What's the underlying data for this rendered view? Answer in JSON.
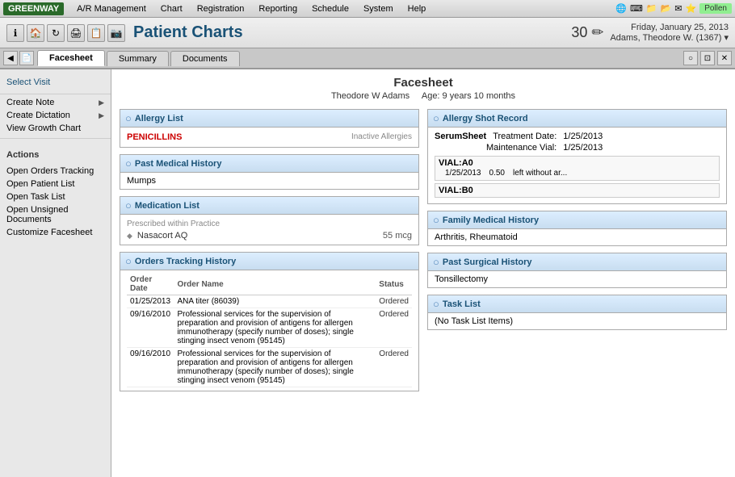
{
  "app": {
    "logo": "GREENWAY",
    "title": "Patient Charts",
    "date": "Friday, January 25, 2013",
    "patient_info": "Adams, Theodore W. (1367) ▾",
    "num_badge": "30",
    "pollen": "Pollen"
  },
  "menu": {
    "items": [
      "A/R Management",
      "Chart",
      "Registration",
      "Reporting",
      "Schedule",
      "System",
      "Help"
    ]
  },
  "tabs": {
    "active": "Facesheet",
    "items": [
      "Facesheet",
      "Summary",
      "Documents"
    ]
  },
  "sidebar": {
    "select_visit": "Select Visit",
    "links": [
      {
        "label": "Create Note",
        "arrow": true
      },
      {
        "label": "Create Dictation",
        "arrow": true
      },
      {
        "label": "View Growth Chart",
        "arrow": false
      }
    ],
    "actions_title": "Actions",
    "actions": [
      {
        "label": "Open Orders Tracking"
      },
      {
        "label": "Open Patient List"
      },
      {
        "label": "Open Task List"
      },
      {
        "label": "Open Unsigned Documents"
      },
      {
        "label": "Customize Facesheet"
      }
    ]
  },
  "facesheet": {
    "title": "Facesheet",
    "patient_name": "Theodore W Adams",
    "age": "Age: 9 years 10 months"
  },
  "allergy_list": {
    "section_title": "Allergy List",
    "inactive_label": "Inactive Allergies",
    "items": [
      "PENICILLINS"
    ]
  },
  "allergy_shot": {
    "section_title": "Allergy Shot Record",
    "serum_label": "SerumSheet",
    "treatment_date_label": "Treatment Date:",
    "treatment_date": "1/25/2013",
    "maintenance_label": "Maintenance Vial:",
    "maintenance_date": "1/25/2013",
    "vials": [
      {
        "name": "VIAL:A0",
        "date": "1/25/2013",
        "amount": "0.50",
        "note": "left without ar..."
      },
      {
        "name": "VIAL:B0",
        "date": "",
        "amount": "",
        "note": ""
      }
    ]
  },
  "past_medical": {
    "section_title": "Past Medical History",
    "items": [
      "Mumps"
    ]
  },
  "family_medical": {
    "section_title": "Family Medical History",
    "items": [
      "Arthritis, Rheumatoid"
    ]
  },
  "medication_list": {
    "section_title": "Medication List",
    "prescribed_label": "Prescribed within Practice",
    "items": [
      {
        "name": "Nasacort AQ",
        "dose": "55 mcg"
      }
    ]
  },
  "past_surgical": {
    "section_title": "Past Surgical History",
    "items": [
      "Tonsillectomy"
    ]
  },
  "orders_tracking": {
    "section_title": "Orders Tracking History",
    "columns": [
      "Order Date",
      "Order Name",
      "Status"
    ],
    "rows": [
      {
        "date": "01/25/2013",
        "name": "ANA titer (86039)",
        "status": "Ordered"
      },
      {
        "date": "09/16/2010",
        "name": "Professional services for the supervision of preparation and provision of antigens for allergen immunotherapy (specify number of doses); single stinging insect venom (95145)",
        "status": "Ordered"
      },
      {
        "date": "09/16/2010",
        "name": "Professional services for the supervision of preparation and provision of antigens for allergen immunotherapy (specify number of doses); single stinging insect venom (95145)",
        "status": "Ordered"
      }
    ]
  },
  "task_list": {
    "section_title": "Task List",
    "empty_label": "(No Task List Items)"
  }
}
